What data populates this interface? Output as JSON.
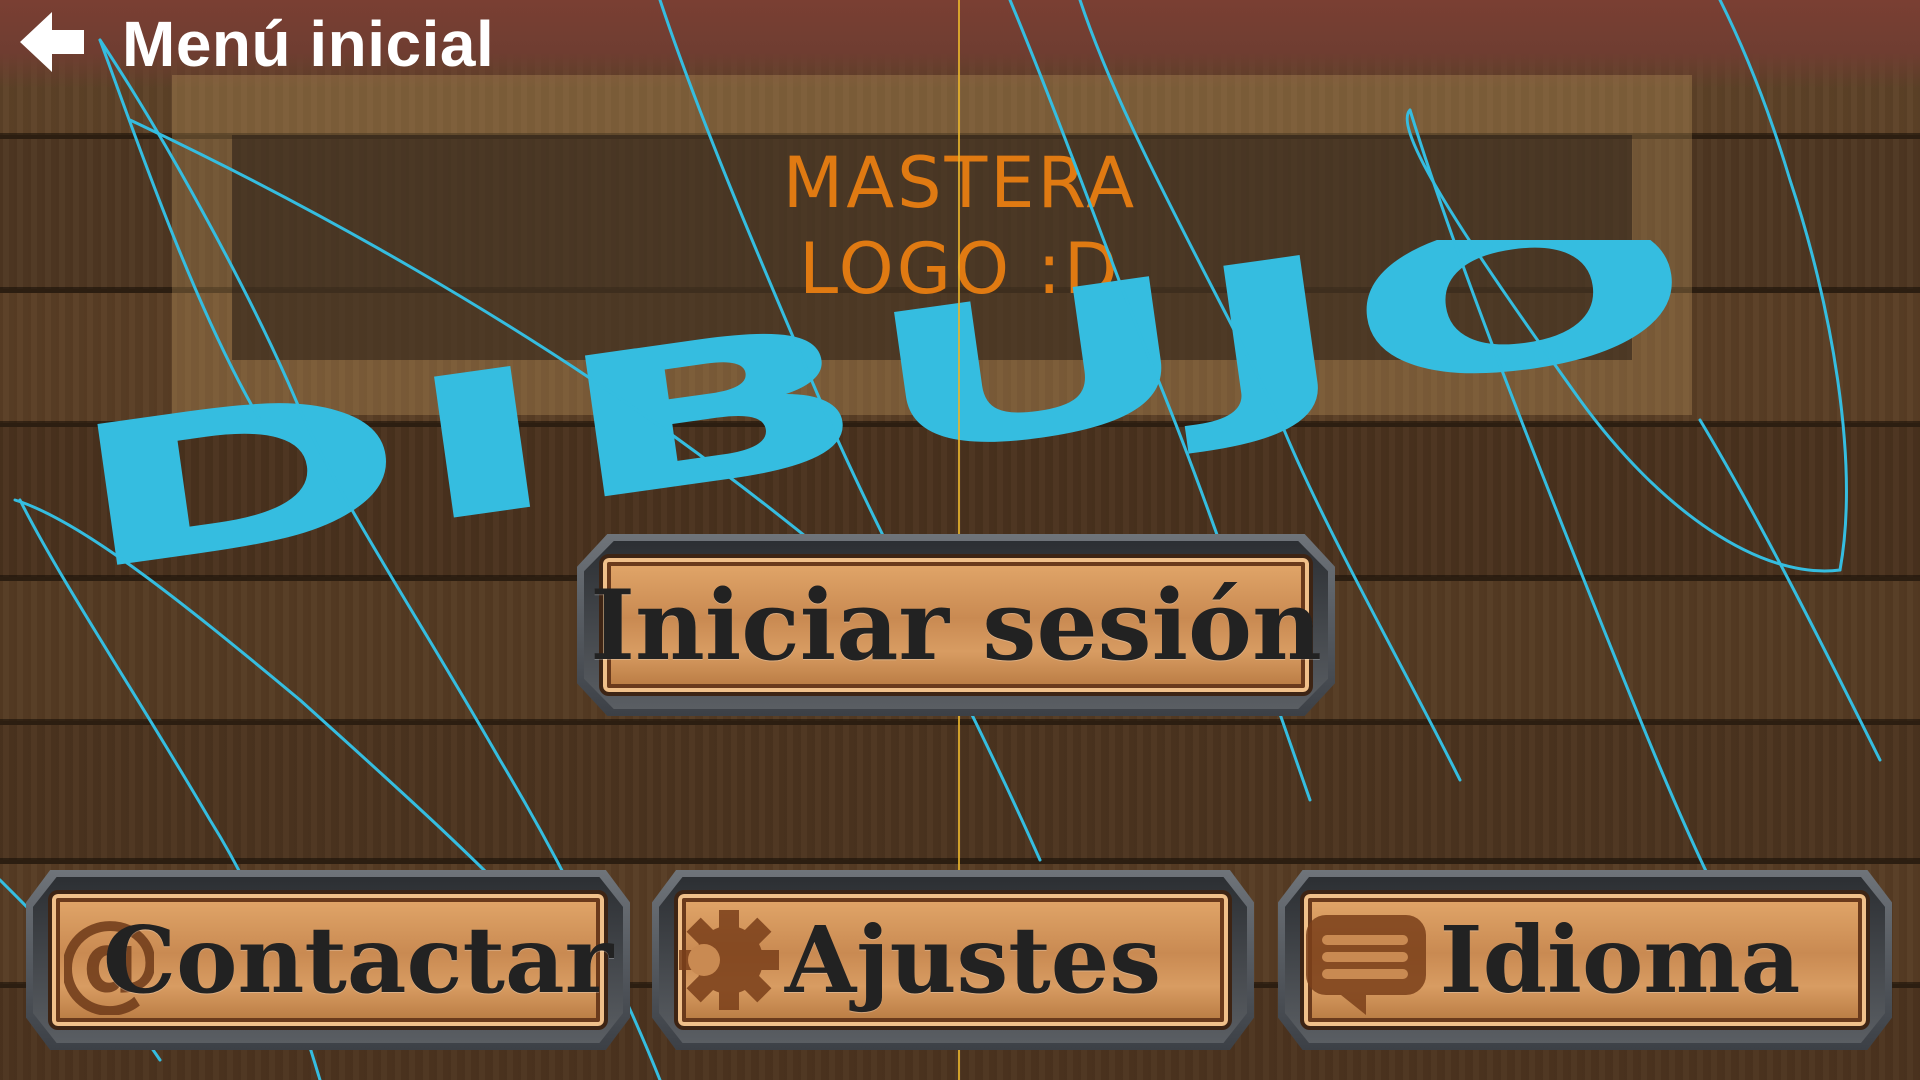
{
  "header": {
    "title": "Menú inicial"
  },
  "logo": {
    "line1": "MASTERA",
    "line2": "LOGO :D"
  },
  "brand": {
    "text": "DIBUJO",
    "color": "#35bde0"
  },
  "buttons": {
    "login": "Iniciar sesión",
    "contact": "Contactar",
    "settings": "Ajustes",
    "language": "Idioma"
  },
  "icons": {
    "back": "arrow-left-icon",
    "contact": "at-sign-icon",
    "settings": "gear-icon",
    "language": "speech-bubble-icon"
  },
  "colors": {
    "topbar": "#7a3f33",
    "logo_text": "#e07a12",
    "scribble": "#35bde0",
    "center_line": "#e7b42c"
  }
}
